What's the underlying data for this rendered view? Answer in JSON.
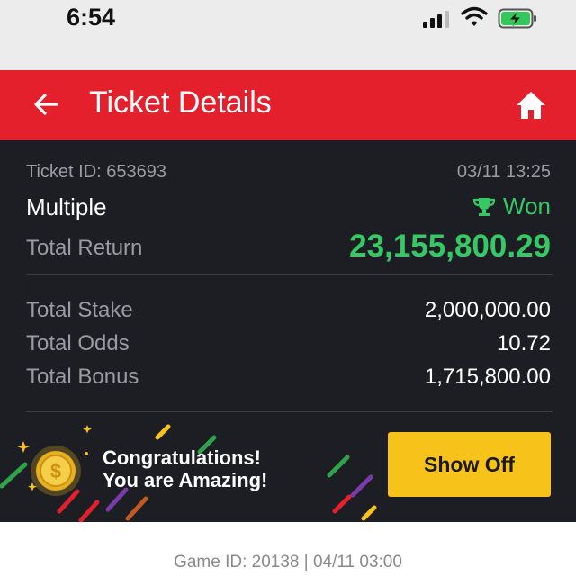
{
  "status_bar": {
    "time": "6:54",
    "icons": [
      "signal-icon",
      "wifi-icon",
      "battery-charging-icon"
    ]
  },
  "header": {
    "title": "Ticket Details",
    "back_icon": "back-arrow-icon",
    "home_icon": "home-icon",
    "background_color": "#e3202b"
  },
  "ticket": {
    "id_text": "Ticket ID: 653693",
    "date": "03/11 13:25",
    "bet_type": "Multiple",
    "status": "Won",
    "status_icon": "trophy-icon",
    "status_color": "#35c865",
    "total_return_label": "Total Return",
    "total_return_value": "23,155,800.29",
    "rows": [
      {
        "label": "Total Stake",
        "value": "2,000,000.00"
      },
      {
        "label": "Total Odds",
        "value": "10.72"
      },
      {
        "label": "Total Bonus",
        "value": "1,715,800.00"
      }
    ]
  },
  "banner": {
    "line1": "Congratulations!",
    "line2": "You are Amazing!",
    "button_label": "Show Off",
    "button_color": "#f7c21a",
    "icon": "coin-icon"
  },
  "footer": {
    "game_id_text": "Game ID: 20138 | 04/11 03:00"
  }
}
